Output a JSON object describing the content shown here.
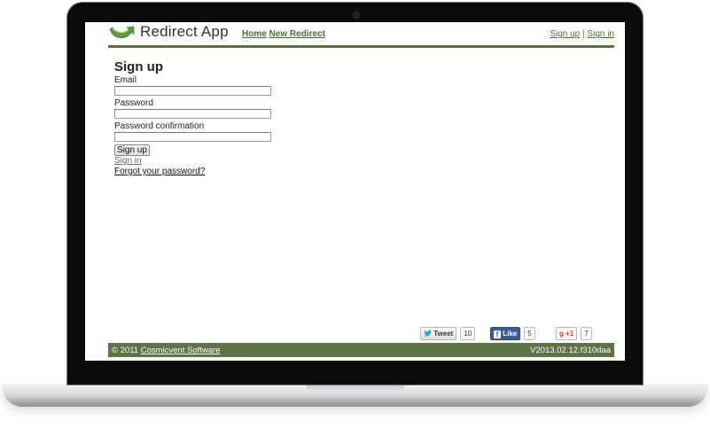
{
  "header": {
    "app_title": "Redirect App",
    "nav": {
      "home": "Home",
      "new_redirect": "New Redirect"
    },
    "auth": {
      "sign_up": "Sign up",
      "separator": "|",
      "sign_in": "Sign in"
    },
    "logo_icon": "green-arrow-logo-icon"
  },
  "form": {
    "heading": "Sign up",
    "email_label": "Email",
    "email_value": "",
    "password_label": "Password",
    "password_value": "",
    "password_confirmation_label": "Password confirmation",
    "password_confirmation_value": "",
    "submit_label": "Sign up",
    "sign_in_link": "Sign in",
    "forgot_password_link": "Forgot your password?"
  },
  "social": {
    "tweet": {
      "label": "Tweet",
      "count": "10"
    },
    "like": {
      "label": "Like",
      "count": "5"
    },
    "gplus": {
      "label": "+1",
      "count": "7"
    }
  },
  "footer": {
    "copyright": "© 2011",
    "company_link": "Cosmicvent Software",
    "version": "V2013.02.12.f310daa"
  },
  "colors": {
    "brand_green": "#5d7344",
    "link_green": "#4f6a34",
    "facebook_blue": "#3b5998",
    "twitter_blue": "#1da1f2"
  }
}
